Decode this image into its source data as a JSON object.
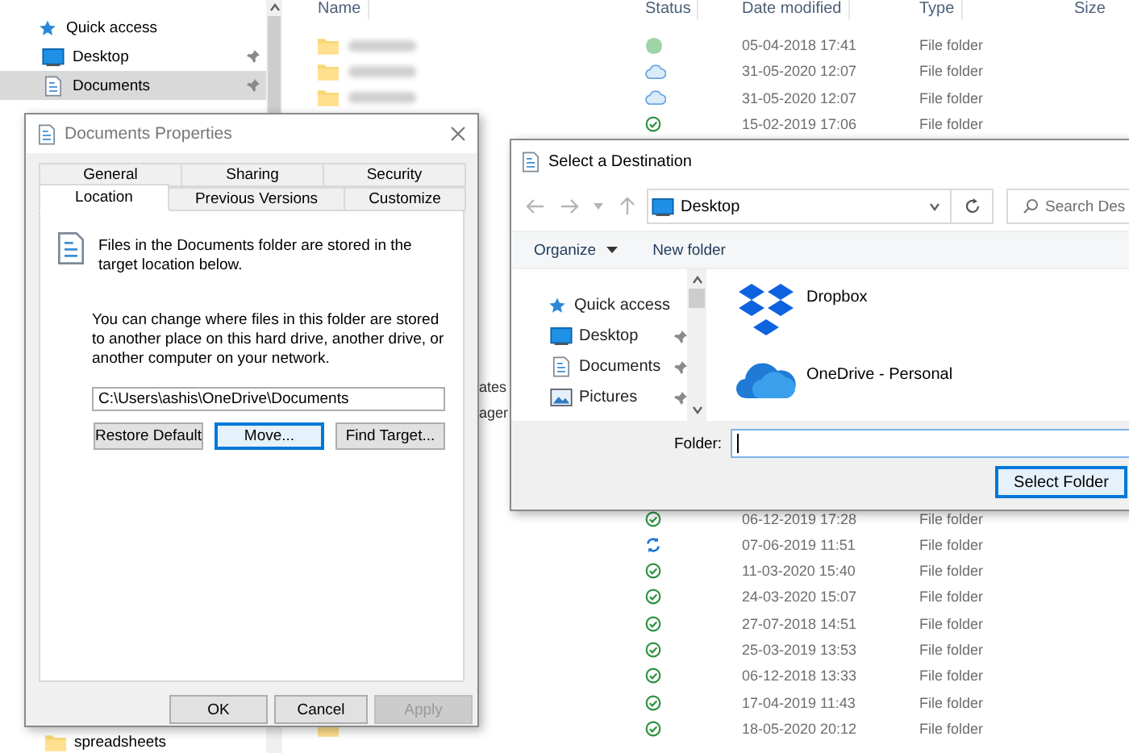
{
  "explorer": {
    "nav": [
      {
        "label": "Quick access",
        "kind": "star",
        "pinned": false,
        "selected": false
      },
      {
        "label": "Desktop",
        "kind": "desktop",
        "pinned": true,
        "selected": false
      },
      {
        "label": "Documents",
        "kind": "document",
        "pinned": true,
        "selected": true
      }
    ],
    "nav_bottom": [
      {
        "label": "spreadsheets",
        "kind": "folder",
        "pinned": false,
        "selected": false
      }
    ],
    "columns": [
      "Name",
      "Status",
      "Date modified",
      "Type",
      "Size"
    ],
    "rows_top": [
      {
        "kind": "dot",
        "date": "05-04-2018 17:41",
        "type": "File folder"
      },
      {
        "kind": "cloud",
        "date": "31-05-2020 12:07",
        "type": "File folder"
      },
      {
        "kind": "cloud",
        "date": "31-05-2020 12:07",
        "type": "File folder"
      },
      {
        "kind": "check",
        "date": "15-02-2019 17:06",
        "type": "File folder"
      }
    ],
    "rows_middle": [
      {
        "name": "ates"
      },
      {
        "name": "ager"
      }
    ],
    "rows_bottom": [
      {
        "kind": "check",
        "date": "06-12-2019 17:28",
        "type": "File folder"
      },
      {
        "kind": "sync",
        "date": "07-06-2019 11:51",
        "type": "File folder"
      },
      {
        "kind": "check",
        "date": "11-03-2020 15:40",
        "type": "File folder"
      },
      {
        "kind": "check",
        "date": "24-03-2020 15:07",
        "type": "File folder"
      },
      {
        "kind": "check",
        "date": "27-07-2018 14:51",
        "type": "File folder"
      },
      {
        "kind": "check",
        "date": "25-03-2019 13:53",
        "type": "File folder"
      },
      {
        "kind": "check",
        "date": "06-12-2018 13:33",
        "type": "File folder"
      },
      {
        "kind": "check",
        "date": "17-04-2019 11:43",
        "type": "File folder"
      },
      {
        "kind": "check",
        "date": "18-05-2020 20:12",
        "type": "File folder"
      }
    ]
  },
  "properties_dialog": {
    "title": "Documents Properties",
    "tab_rows": [
      [
        {
          "label": "General",
          "selected": false
        },
        {
          "label": "Sharing",
          "selected": false
        },
        {
          "label": "Security",
          "selected": false
        }
      ],
      [
        {
          "label": "Location",
          "selected": true
        },
        {
          "label": "Previous Versions",
          "selected": false
        },
        {
          "label": "Customize",
          "selected": false
        }
      ]
    ],
    "info": "Files in the Documents folder are stored in the target location below.",
    "description": "You can change where files in this folder are stored to another place on this hard drive, another drive, or another computer on your network.",
    "path": "C:\\Users\\ashis\\OneDrive\\Documents",
    "buttons": [
      {
        "label": "Restore Default",
        "focused": false
      },
      {
        "label": "Move...",
        "focused": true
      },
      {
        "label": "Find Target...",
        "focused": false
      }
    ],
    "footer_buttons": [
      {
        "label": "OK",
        "disabled": false
      },
      {
        "label": "Cancel",
        "disabled": false
      },
      {
        "label": "Apply",
        "disabled": true
      }
    ]
  },
  "destination_dialog": {
    "title": "Select a Destination",
    "address": "Desktop",
    "search": {
      "placeholder": "Search Des"
    },
    "toolbar": [
      {
        "label": "Organize",
        "dropdown": true
      },
      {
        "label": "New folder",
        "dropdown": false
      }
    ],
    "nav": [
      {
        "label": "Quick access",
        "kind": "star",
        "pinned": false
      },
      {
        "label": "Desktop",
        "kind": "desktop",
        "pinned": true
      },
      {
        "label": "Documents",
        "kind": "document",
        "pinned": true
      },
      {
        "label": "Pictures",
        "kind": "pictures",
        "pinned": true
      }
    ],
    "items": [
      {
        "label": "Dropbox",
        "kind": "dropbox"
      },
      {
        "label": "OneDrive - Personal",
        "kind": "onedrive"
      }
    ],
    "folder_label": "Folder:",
    "button": {
      "label": "Select Folder",
      "focused": true
    }
  }
}
